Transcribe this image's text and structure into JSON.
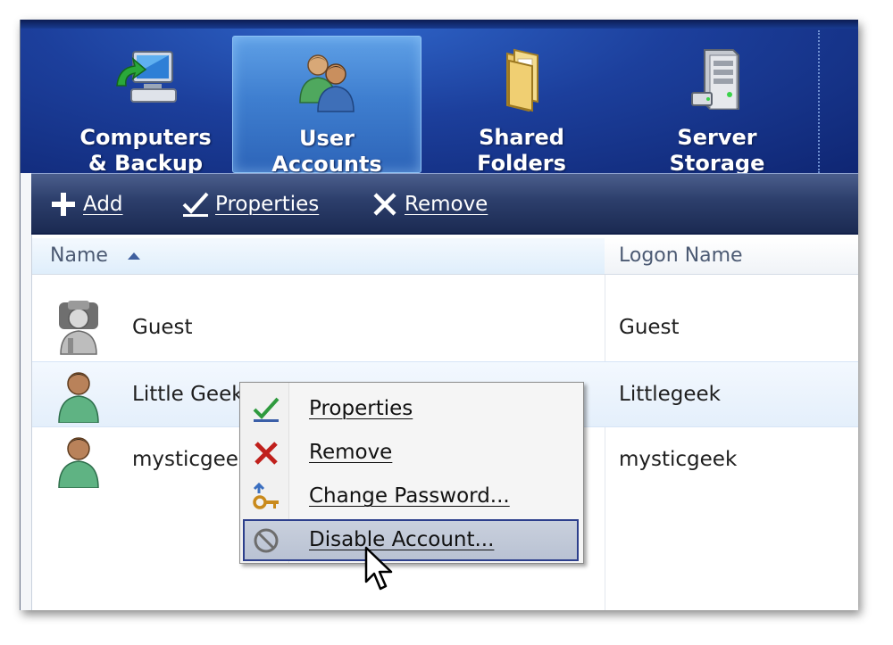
{
  "nav": {
    "tabs": [
      {
        "label": "Computers\n& Backup",
        "icon": "computer-backup-icon",
        "active": false
      },
      {
        "label": "User\nAccounts",
        "icon": "user-accounts-icon",
        "active": true
      },
      {
        "label": "Shared\nFolders",
        "icon": "shared-folders-icon",
        "active": false
      },
      {
        "label": "Server\nStorage",
        "icon": "server-storage-icon",
        "active": false
      }
    ]
  },
  "toolbar": {
    "add_label": "Add",
    "properties_label": "Properties",
    "remove_label": "Remove"
  },
  "list": {
    "columns": {
      "name": "Name",
      "logon": "Logon Name"
    },
    "sort": "Name ascending",
    "rows": [
      {
        "name": "Guest",
        "logon": "Guest",
        "avatar": "guest-avatar-icon",
        "selected": false
      },
      {
        "name": "Little Geek",
        "logon": "Littlegeek",
        "avatar": "user-avatar-icon",
        "selected": true
      },
      {
        "name": "mysticgeek",
        "logon": "mysticgeek",
        "avatar": "user-avatar-icon",
        "selected": false
      }
    ]
  },
  "context_menu": {
    "items": [
      {
        "label": "Properties",
        "icon": "checkmark-icon"
      },
      {
        "label": "Remove",
        "icon": "red-x-icon"
      },
      {
        "label": "Change Password...",
        "icon": "key-icon"
      },
      {
        "label": "Disable Account...",
        "icon": "disable-icon",
        "hover": true
      }
    ]
  },
  "colors": {
    "nav_blue": "#1c3f9c",
    "active_tab": "#3f7fd0",
    "toolbar": "#2c3e6b",
    "menu_hover": "#c1c9d8",
    "menu_hover_border": "#2c3f8c",
    "remove_red": "#c0201c"
  }
}
